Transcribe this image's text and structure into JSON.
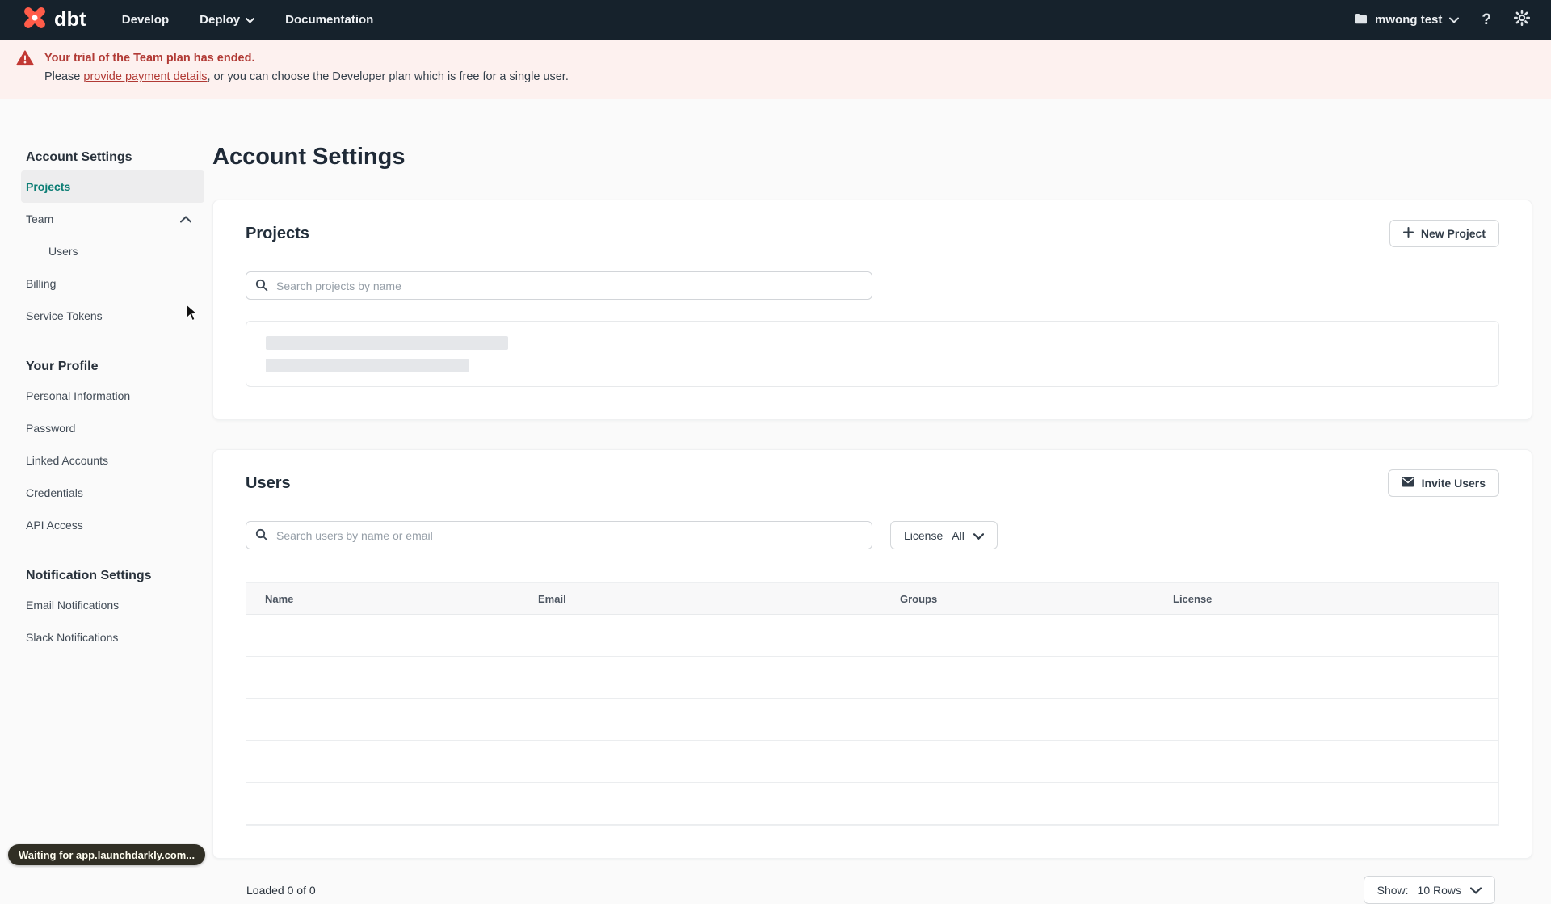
{
  "topnav": {
    "logo": "dbt",
    "menu": [
      {
        "label": "Develop"
      },
      {
        "label": "Deploy"
      },
      {
        "label": "Documentation"
      }
    ],
    "account_name": "mwong test"
  },
  "banner": {
    "title": "Your trial of the Team plan has ended.",
    "body_prefix": "Please ",
    "link_text": "provide payment details",
    "body_suffix": ", or you can choose the Developer plan which is free for a single user."
  },
  "sidebar": {
    "account_heading": "Account Settings",
    "projects": "Projects",
    "team": "Team",
    "users": "Users",
    "billing": "Billing",
    "service_tokens": "Service Tokens",
    "profile_heading": "Your Profile",
    "personal_information": "Personal Information",
    "password": "Password",
    "linked_accounts": "Linked Accounts",
    "credentials": "Credentials",
    "api_access": "API Access",
    "notifications_heading": "Notification Settings",
    "email_notifications": "Email Notifications",
    "slack_notifications": "Slack Notifications"
  },
  "main": {
    "page_title": "Account Settings",
    "projects": {
      "title": "Projects",
      "new_button": "New Project",
      "search_placeholder": "Search projects by name"
    },
    "users": {
      "title": "Users",
      "invite_button": "Invite Users",
      "search_placeholder": "Search users by name or email",
      "license_label": "License",
      "license_value": "All",
      "columns": [
        "Name",
        "Email",
        "Groups",
        "License"
      ]
    },
    "footer": {
      "loaded": "Loaded 0 of 0",
      "show_label": "Show:",
      "show_value": "10 Rows"
    }
  },
  "status_bubble": {
    "text": "Waiting for app.launchdarkly.com..."
  },
  "colors": {
    "accent_orange": "#ff5c49",
    "brand_teal": "#0b7d74",
    "nav_bg": "#16222c",
    "banner_bg": "#fdf1ef",
    "alert_red": "#b13a35",
    "skeleton": "#e5e7ea"
  }
}
